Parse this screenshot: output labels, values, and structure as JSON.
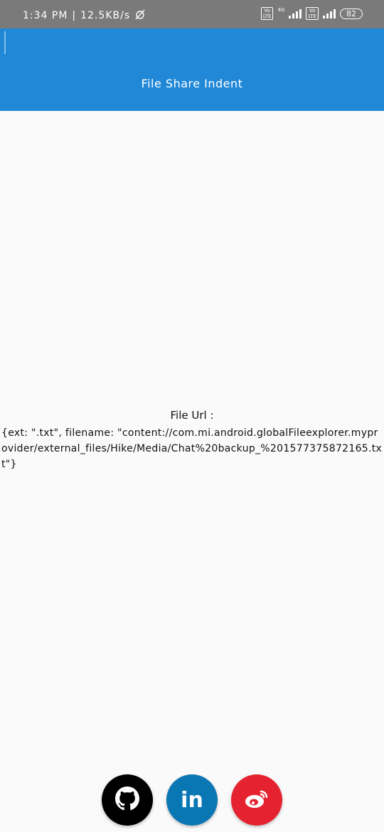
{
  "status_bar": {
    "time": "1:34 PM",
    "separator": "|",
    "speed": "12.5KB/s",
    "network_type": "4G",
    "volte_label": "Vo\nLTE",
    "battery": "82"
  },
  "app_bar": {
    "title": "File Share Indent",
    "color": "#2188d8"
  },
  "content": {
    "label": "File Url  :",
    "url": "{ext: \".txt\", filename: \"content://com.mi.android.globalFileexplorer.myprovider/external_files/Hike/Media/Chat%20backup_%201577375872165.txt\"}"
  },
  "fabs": [
    {
      "name": "github",
      "icon": "github-icon",
      "color": "#000000"
    },
    {
      "name": "linkedin",
      "icon": "linkedin-icon",
      "label": "in",
      "color": "#0a77b5"
    },
    {
      "name": "weibo",
      "icon": "weibo-icon",
      "color": "#e52330"
    }
  ]
}
